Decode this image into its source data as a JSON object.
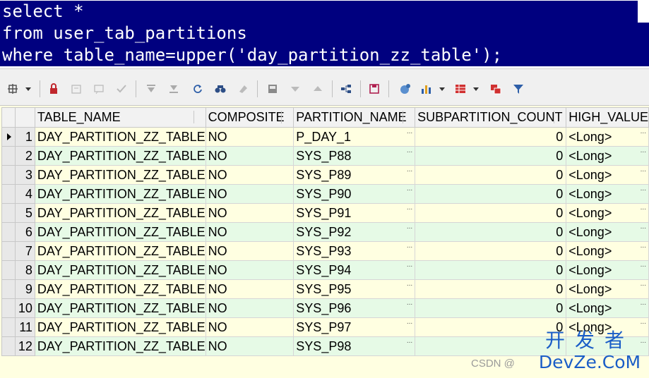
{
  "editor": {
    "lines": [
      "select *",
      "from user_tab_partitions",
      "where table_name=upper('day_partition_zz_table');"
    ]
  },
  "toolbar": {
    "icons": [
      "query-options-icon",
      "lock-icon",
      "insert-record-icon",
      "delete-record-icon",
      "post-edit-icon",
      "first-record-icon",
      "last-record-icon",
      "refresh-icon",
      "find-icon",
      "clear-icon",
      "save-icon",
      "move-down-icon",
      "move-up-icon",
      "tree-icon",
      "save-disk-icon",
      "export-icon",
      "chart-icon",
      "grid-icon",
      "compare-icon",
      "filter-icon"
    ]
  },
  "grid": {
    "columns": [
      "TABLE_NAME",
      "COMPOSITE",
      "PARTITION_NAME",
      "SUBPARTITION_COUNT",
      "HIGH_VALUE"
    ],
    "rows": [
      {
        "num": "1",
        "table_name": "DAY_PARTITION_ZZ_TABLE",
        "composite": "NO",
        "partition_name": "P_DAY_1",
        "subpartition_count": "0",
        "high_value": "<Long>"
      },
      {
        "num": "2",
        "table_name": "DAY_PARTITION_ZZ_TABLE",
        "composite": "NO",
        "partition_name": "SYS_P88",
        "subpartition_count": "0",
        "high_value": "<Long>"
      },
      {
        "num": "3",
        "table_name": "DAY_PARTITION_ZZ_TABLE",
        "composite": "NO",
        "partition_name": "SYS_P89",
        "subpartition_count": "0",
        "high_value": "<Long>"
      },
      {
        "num": "4",
        "table_name": "DAY_PARTITION_ZZ_TABLE",
        "composite": "NO",
        "partition_name": "SYS_P90",
        "subpartition_count": "0",
        "high_value": "<Long>"
      },
      {
        "num": "5",
        "table_name": "DAY_PARTITION_ZZ_TABLE",
        "composite": "NO",
        "partition_name": "SYS_P91",
        "subpartition_count": "0",
        "high_value": "<Long>"
      },
      {
        "num": "6",
        "table_name": "DAY_PARTITION_ZZ_TABLE",
        "composite": "NO",
        "partition_name": "SYS_P92",
        "subpartition_count": "0",
        "high_value": "<Long>"
      },
      {
        "num": "7",
        "table_name": "DAY_PARTITION_ZZ_TABLE",
        "composite": "NO",
        "partition_name": "SYS_P93",
        "subpartition_count": "0",
        "high_value": "<Long>"
      },
      {
        "num": "8",
        "table_name": "DAY_PARTITION_ZZ_TABLE",
        "composite": "NO",
        "partition_name": "SYS_P94",
        "subpartition_count": "0",
        "high_value": "<Long>"
      },
      {
        "num": "9",
        "table_name": "DAY_PARTITION_ZZ_TABLE",
        "composite": "NO",
        "partition_name": "SYS_P95",
        "subpartition_count": "0",
        "high_value": "<Long>"
      },
      {
        "num": "10",
        "table_name": "DAY_PARTITION_ZZ_TABLE",
        "composite": "NO",
        "partition_name": "SYS_P96",
        "subpartition_count": "0",
        "high_value": "<Long>"
      },
      {
        "num": "11",
        "table_name": "DAY_PARTITION_ZZ_TABLE",
        "composite": "NO",
        "partition_name": "SYS_P97",
        "subpartition_count": "0",
        "high_value": "<Long>"
      },
      {
        "num": "12",
        "table_name": "DAY_PARTITION_ZZ_TABLE",
        "composite": "NO",
        "partition_name": "SYS_P98",
        "subpartition_count": "",
        "high_value": ""
      }
    ],
    "cell_ellipsis": "..."
  },
  "watermark": {
    "csdn": "CSDN @",
    "logo_cn": "开发者",
    "logo_en": "DevZe.CoM"
  },
  "colors": {
    "selection": "#00007f",
    "row_odd": "#ffffe1",
    "row_even": "#e6fae6",
    "logo": "#1a5dc7"
  }
}
